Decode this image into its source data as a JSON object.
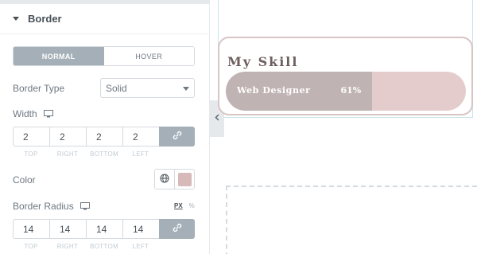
{
  "panel": {
    "section_title": "Border",
    "tabs": [
      {
        "label": "NORMAL",
        "active": true
      },
      {
        "label": "HOVER",
        "active": false
      }
    ],
    "border_type": {
      "label": "Border Type",
      "value": "Solid"
    },
    "width": {
      "label": "Width",
      "values": [
        "2",
        "2",
        "2",
        "2"
      ],
      "captions": [
        "TOP",
        "RIGHT",
        "BOTTOM",
        "LEFT"
      ]
    },
    "color": {
      "label": "Color",
      "swatch": "#d8b9b9"
    },
    "border_radius": {
      "label": "Border Radius",
      "units": [
        "PX",
        "%"
      ],
      "active_unit": "PX",
      "values": [
        "14",
        "14",
        "14",
        "14"
      ],
      "captions": [
        "TOP",
        "RIGHT",
        "BOTTOM",
        "LEFT"
      ]
    }
  },
  "preview": {
    "skill_title": "My Skill",
    "bar_label": "Web Designer",
    "bar_percent_text": "61%",
    "bar_percent": 0.61,
    "colors": {
      "fill": "#c0b3b3",
      "track": "#e5cccc",
      "card_border": "#d8c5c5"
    }
  },
  "icons": [
    "caret-down-icon",
    "monitor-icon",
    "link-icon",
    "globe-icon",
    "chevron-left-icon"
  ]
}
